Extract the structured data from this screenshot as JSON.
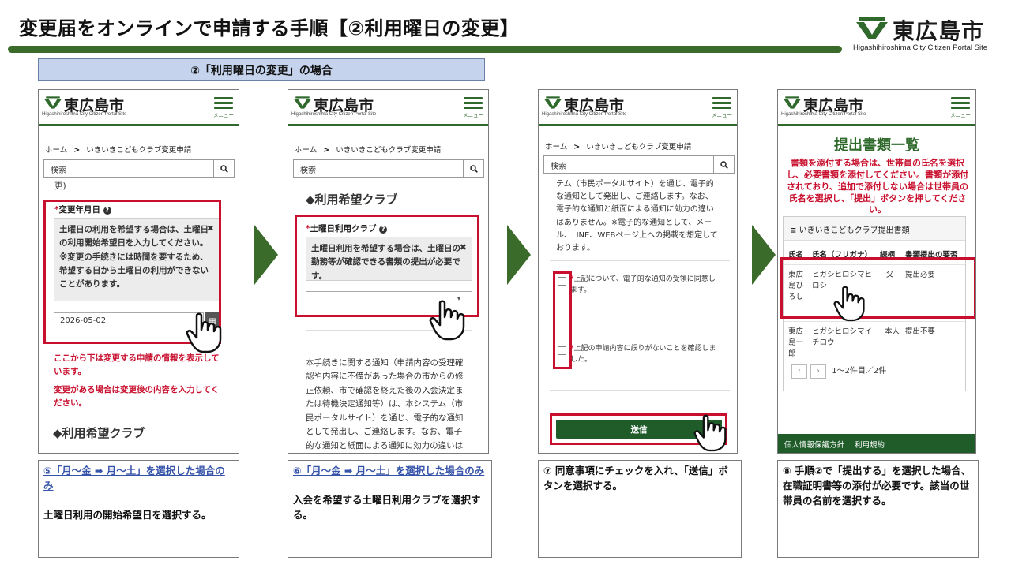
{
  "slide": {
    "title": "変更届をオンラインで申請する手順【②利用曜日の変更】",
    "section_label": "②「利用曜日の変更」の場合"
  },
  "brand": {
    "name": "東広島市",
    "subtitle": "Higashihiroshima City Citizen Portal Site",
    "color": "#2f6a2c"
  },
  "phone_common": {
    "logo_text": "東広島市",
    "logo_sub": "Higashihiroshima City Citizen Portal Site",
    "menu_label": "メニュー",
    "crumb_home": "ホーム",
    "crumb_sep": ">",
    "crumb_page": "いきいきこどもクラブ変更申請",
    "search_placeholder": "検索"
  },
  "phone1": {
    "top_fragment": "更)",
    "field_label": "変更年月日",
    "notice_text": "土曜日の利用を希望する場合は、土曜日の利用開始希望日を入力してください。※変更の手続きには時間を要するため、希望する日から土曜日の利用ができないことがあります。",
    "date_value": "2026-05-02",
    "red_note1": "ここから下は変更する申請の情報を表示しています。",
    "red_note2": "変更がある場合は変更後の内容を入力してください。",
    "section_heading": "◆利用希望クラブ"
  },
  "phone2": {
    "section_heading": "◆利用希望クラブ",
    "field_label": "土曜日利用クラブ",
    "notice_text": "土曜日利用を希望する場合は、土曜日の勤務等が確認できる書類の提出が必要です。",
    "select_value": "",
    "info_text": "本手続きに関する通知（申請内容の受理確認や内容に不備があった場合の市からの修正依頼、市で確認を終えた後の入会決定または待機決定通知等）は、本システム（市民ポータルサイト）を通じ、電子的な通知として発出し、ご連絡します。なお、電子的な通知と紙面による通知に効力の違いはありません。"
  },
  "phone3": {
    "info_text": "テム（市民ポータルサイト）を通じ、電子的な通知として発出し、ご連絡します。なお、電子的な通知と紙面による通知に効力の違いはありません。※電子的な通知として、メール、LINE、WEBページ上への掲載を想定しております。",
    "check1_label": "上記について、電子的な通知の受領に同意します。",
    "check2_label": "上記の申請内容に誤りがないことを確認しました。",
    "send_label": "送信"
  },
  "phone4": {
    "title": "提出書類一覧",
    "alert": "書類を添付する場合は、世帯員の氏名を選択し、必要書類を添付してください。書類が添付されており、追加で添付しない場合は世帯員の氏名を選択し、「提出」ボタンを押してください。",
    "table_title": "いきいきこどもクラブ提出書類",
    "columns": [
      "氏名",
      "氏名（フリガナ）",
      "続柄",
      "書類提出の要否"
    ],
    "rows": [
      {
        "name": "東広島ひろし",
        "kana": "ヒガシヒロシマヒロシ",
        "relation": "父",
        "need": "提出必要"
      },
      {
        "name": "東広島一郎",
        "kana": "ヒガシヒロシマイチロウ",
        "relation": "本人",
        "need": "提出不要"
      }
    ],
    "pager_text": "1〜2件目／2件",
    "footer_links": [
      "個人情報保護方針",
      "利用規約"
    ]
  },
  "captions": {
    "c1_link": "⑤「月～金 ➡ 月～土」を選択した場合のみ",
    "c1_text": "土曜日利用の開始希望日を選択する。",
    "c2_link": "⑥「月～金 ➡ 月～土」を選択した場合のみ",
    "c2_text": "入会を希望する土曜日利用クラブを選択する。",
    "c3_text": "⑦ 同意事項にチェックを入れ、「送信」ボタンを選択する。",
    "c4_text": "⑧ 手順②で「提出する」を選択した場合、在職証明書等の添付が必要です。該当の世帯員の名前を選択する。"
  },
  "colors": {
    "accent_green": "#3a6b2a",
    "highlight_red": "#c8102e",
    "section_blue": "#c5d3ec",
    "link_blue": "#3553a8"
  }
}
